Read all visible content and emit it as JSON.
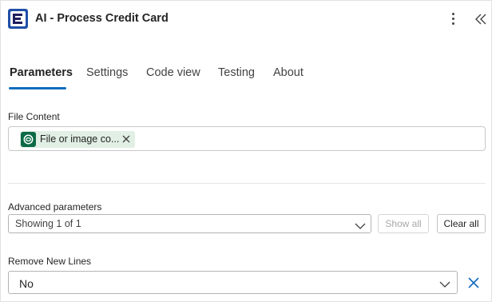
{
  "header": {
    "title": "AI - Process Credit Card",
    "app_icon": "app-logo-icon",
    "more_icon": "more-vertical-icon",
    "collapse_icon": "double-chevron-left-icon"
  },
  "tabs": [
    {
      "label": "Parameters",
      "active": true
    },
    {
      "label": "Settings",
      "active": false
    },
    {
      "label": "Code view",
      "active": false
    },
    {
      "label": "Testing",
      "active": false
    },
    {
      "label": "About",
      "active": false
    }
  ],
  "file_content": {
    "label": "File Content",
    "token_text": "File or image co...",
    "token_icon": "dataverse-icon"
  },
  "advanced": {
    "label": "Advanced parameters",
    "selected": "Showing 1 of 1",
    "show_all_label": "Show all",
    "clear_all_label": "Clear all"
  },
  "remove_new_lines": {
    "label": "Remove New Lines",
    "selected": "No"
  },
  "colors": {
    "accent": "#0f6cbd",
    "token_bg": "#e1efe4",
    "token_icon": "#0b6a47"
  }
}
